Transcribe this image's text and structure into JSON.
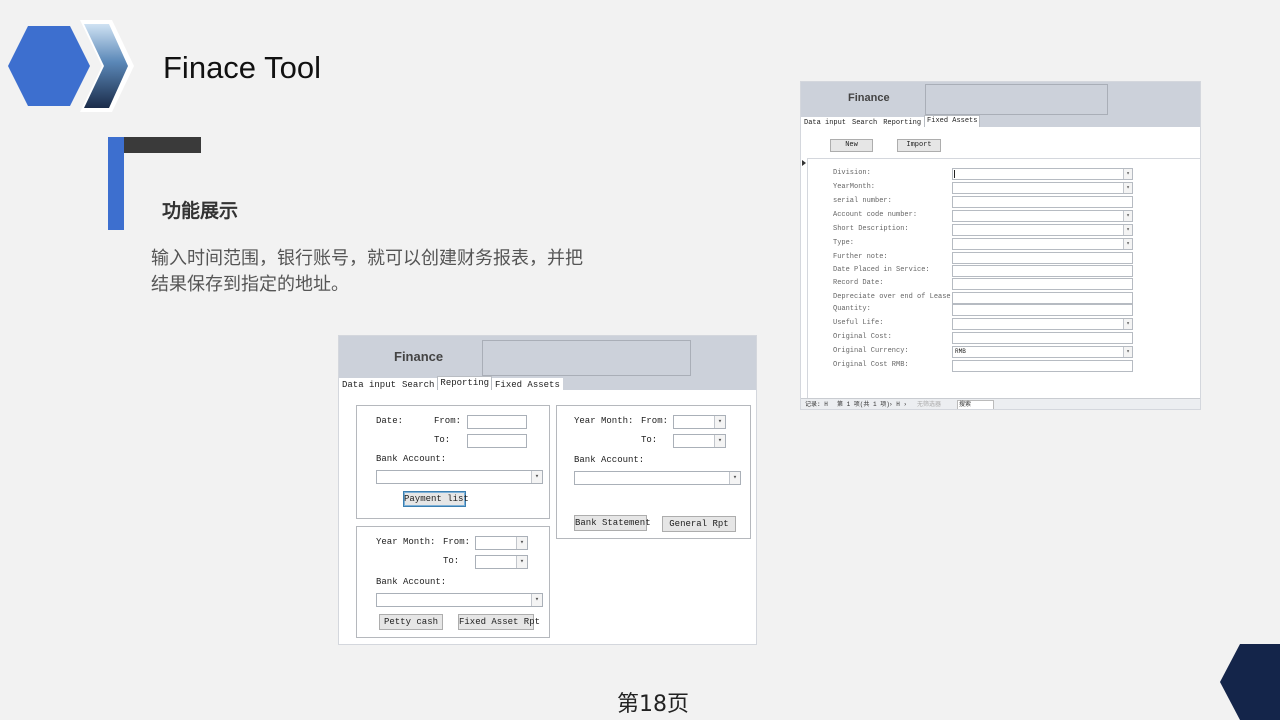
{
  "slide": {
    "title": "Finace Tool",
    "section_heading": "功能展示",
    "description": "输入时间范围，银行账号，就可以创建财务报表，并把结果保存到指定的地址。",
    "page_number": "第18页",
    "colors": {
      "accent": "#3d6fcf",
      "dark": "#3a3a3a",
      "navy": "#14254a"
    }
  },
  "report_app": {
    "title": "Finance",
    "tabs": [
      "Data input",
      "Search",
      "Reporting",
      "Fixed Assets"
    ],
    "active_tab": "Reporting",
    "date_group": {
      "date_label": "Date:",
      "from_label": "From:",
      "to_label": "To:",
      "bank_account_label": "Bank Account:",
      "from_value": "",
      "to_value": "",
      "button": "Payment list"
    },
    "year_month_group_bottom": {
      "year_month_label": "Year Month:",
      "from_label": "From:",
      "to_label": "To:",
      "bank_account_label": "Bank Account:",
      "buttons": [
        "Petty cash",
        "Fixed Asset Rpt"
      ]
    },
    "year_month_group_right": {
      "year_month_label": "Year Month:",
      "from_label": "From:",
      "to_label": "To:",
      "bank_account_label": "Bank Account:",
      "buttons": [
        "Bank Statement",
        "General Rpt"
      ]
    }
  },
  "assets_app": {
    "title": "Finance",
    "tabs": [
      "Data input",
      "Search",
      "Reporting",
      "Fixed Assets"
    ],
    "active_tab": "Fixed Assets",
    "buttons": [
      "New",
      "Import"
    ],
    "fields": [
      {
        "label": "Division:",
        "type": "combo",
        "value": ""
      },
      {
        "label": "YearMonth:",
        "type": "combo",
        "value": ""
      },
      {
        "label": "serial number:",
        "type": "text",
        "value": ""
      },
      {
        "label": "Account code number:",
        "type": "combo",
        "value": ""
      },
      {
        "label": "Short Description:",
        "type": "combo",
        "value": ""
      },
      {
        "label": "Type:",
        "type": "combo",
        "value": ""
      },
      {
        "label": "Further note:",
        "type": "text",
        "value": ""
      },
      {
        "label": "Date Placed in Service:",
        "type": "text",
        "value": ""
      },
      {
        "label": "Record Date:",
        "type": "text",
        "value": ""
      },
      {
        "label": "Depreciate over end of Lease:",
        "type": "text",
        "value": ""
      },
      {
        "label": "Quantity:",
        "type": "text",
        "value": ""
      },
      {
        "label": "Useful Life:",
        "type": "combo",
        "value": ""
      },
      {
        "label": "Original Cost:",
        "type": "text",
        "value": ""
      },
      {
        "label": "Original Currency:",
        "type": "combo",
        "value": "RMB"
      },
      {
        "label": "Original Cost RMB:",
        "type": "text",
        "value": ""
      }
    ],
    "status_bar": {
      "record_label": "记录: H",
      "record_position": "第 1 项(共 1 项)",
      "nav": "› H ›",
      "filter": "无筛选器",
      "search": "搜索"
    }
  }
}
